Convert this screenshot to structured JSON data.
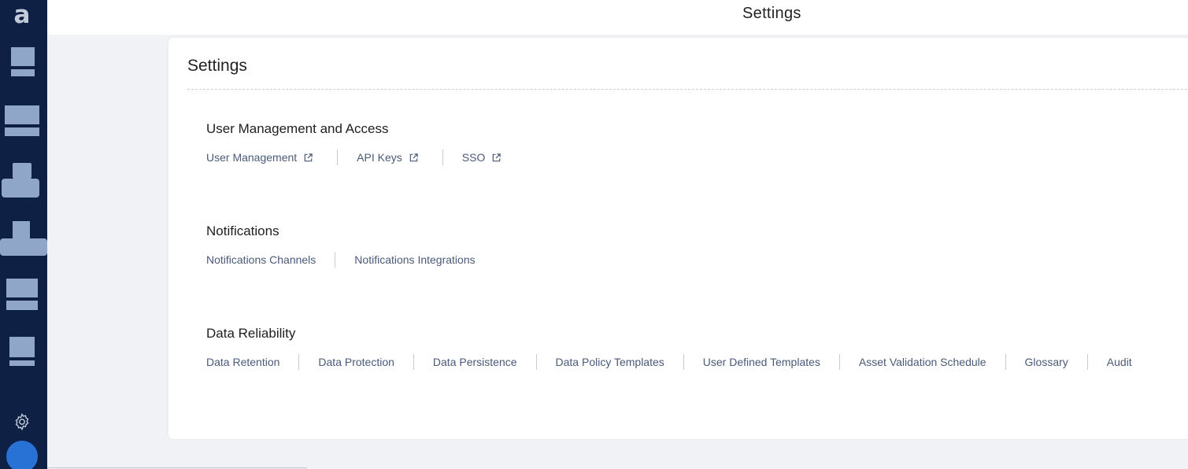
{
  "app": {
    "logo_text": "a",
    "nav_items": [
      "nav-item-1",
      "nav-item-2",
      "nav-item-3",
      "nav-item-4",
      "nav-item-5",
      "nav-item-6"
    ],
    "settings_icon": "gear-icon",
    "avatar_color": "#2872d6"
  },
  "topbar": {
    "title": "Settings"
  },
  "page": {
    "title": "Settings"
  },
  "sections": {
    "user_management": {
      "title": "User Management and Access",
      "links": [
        "User Management",
        "API Keys",
        "SSO"
      ]
    },
    "notifications": {
      "title": "Notifications",
      "links": [
        "Notifications Channels",
        "Notifications Integrations"
      ]
    },
    "data_reliability": {
      "title": "Data Reliability",
      "links": [
        "Data Retention",
        "Data Protection",
        "Data Persistence",
        "Data Policy Templates",
        "User Defined Templates",
        "Asset Validation Schedule",
        "Glossary",
        "Audit"
      ]
    }
  },
  "colors": {
    "sidebar_bg": "#0f2045",
    "sidebar_icon": "#8fa6c8",
    "link_text": "#4a5a78"
  }
}
